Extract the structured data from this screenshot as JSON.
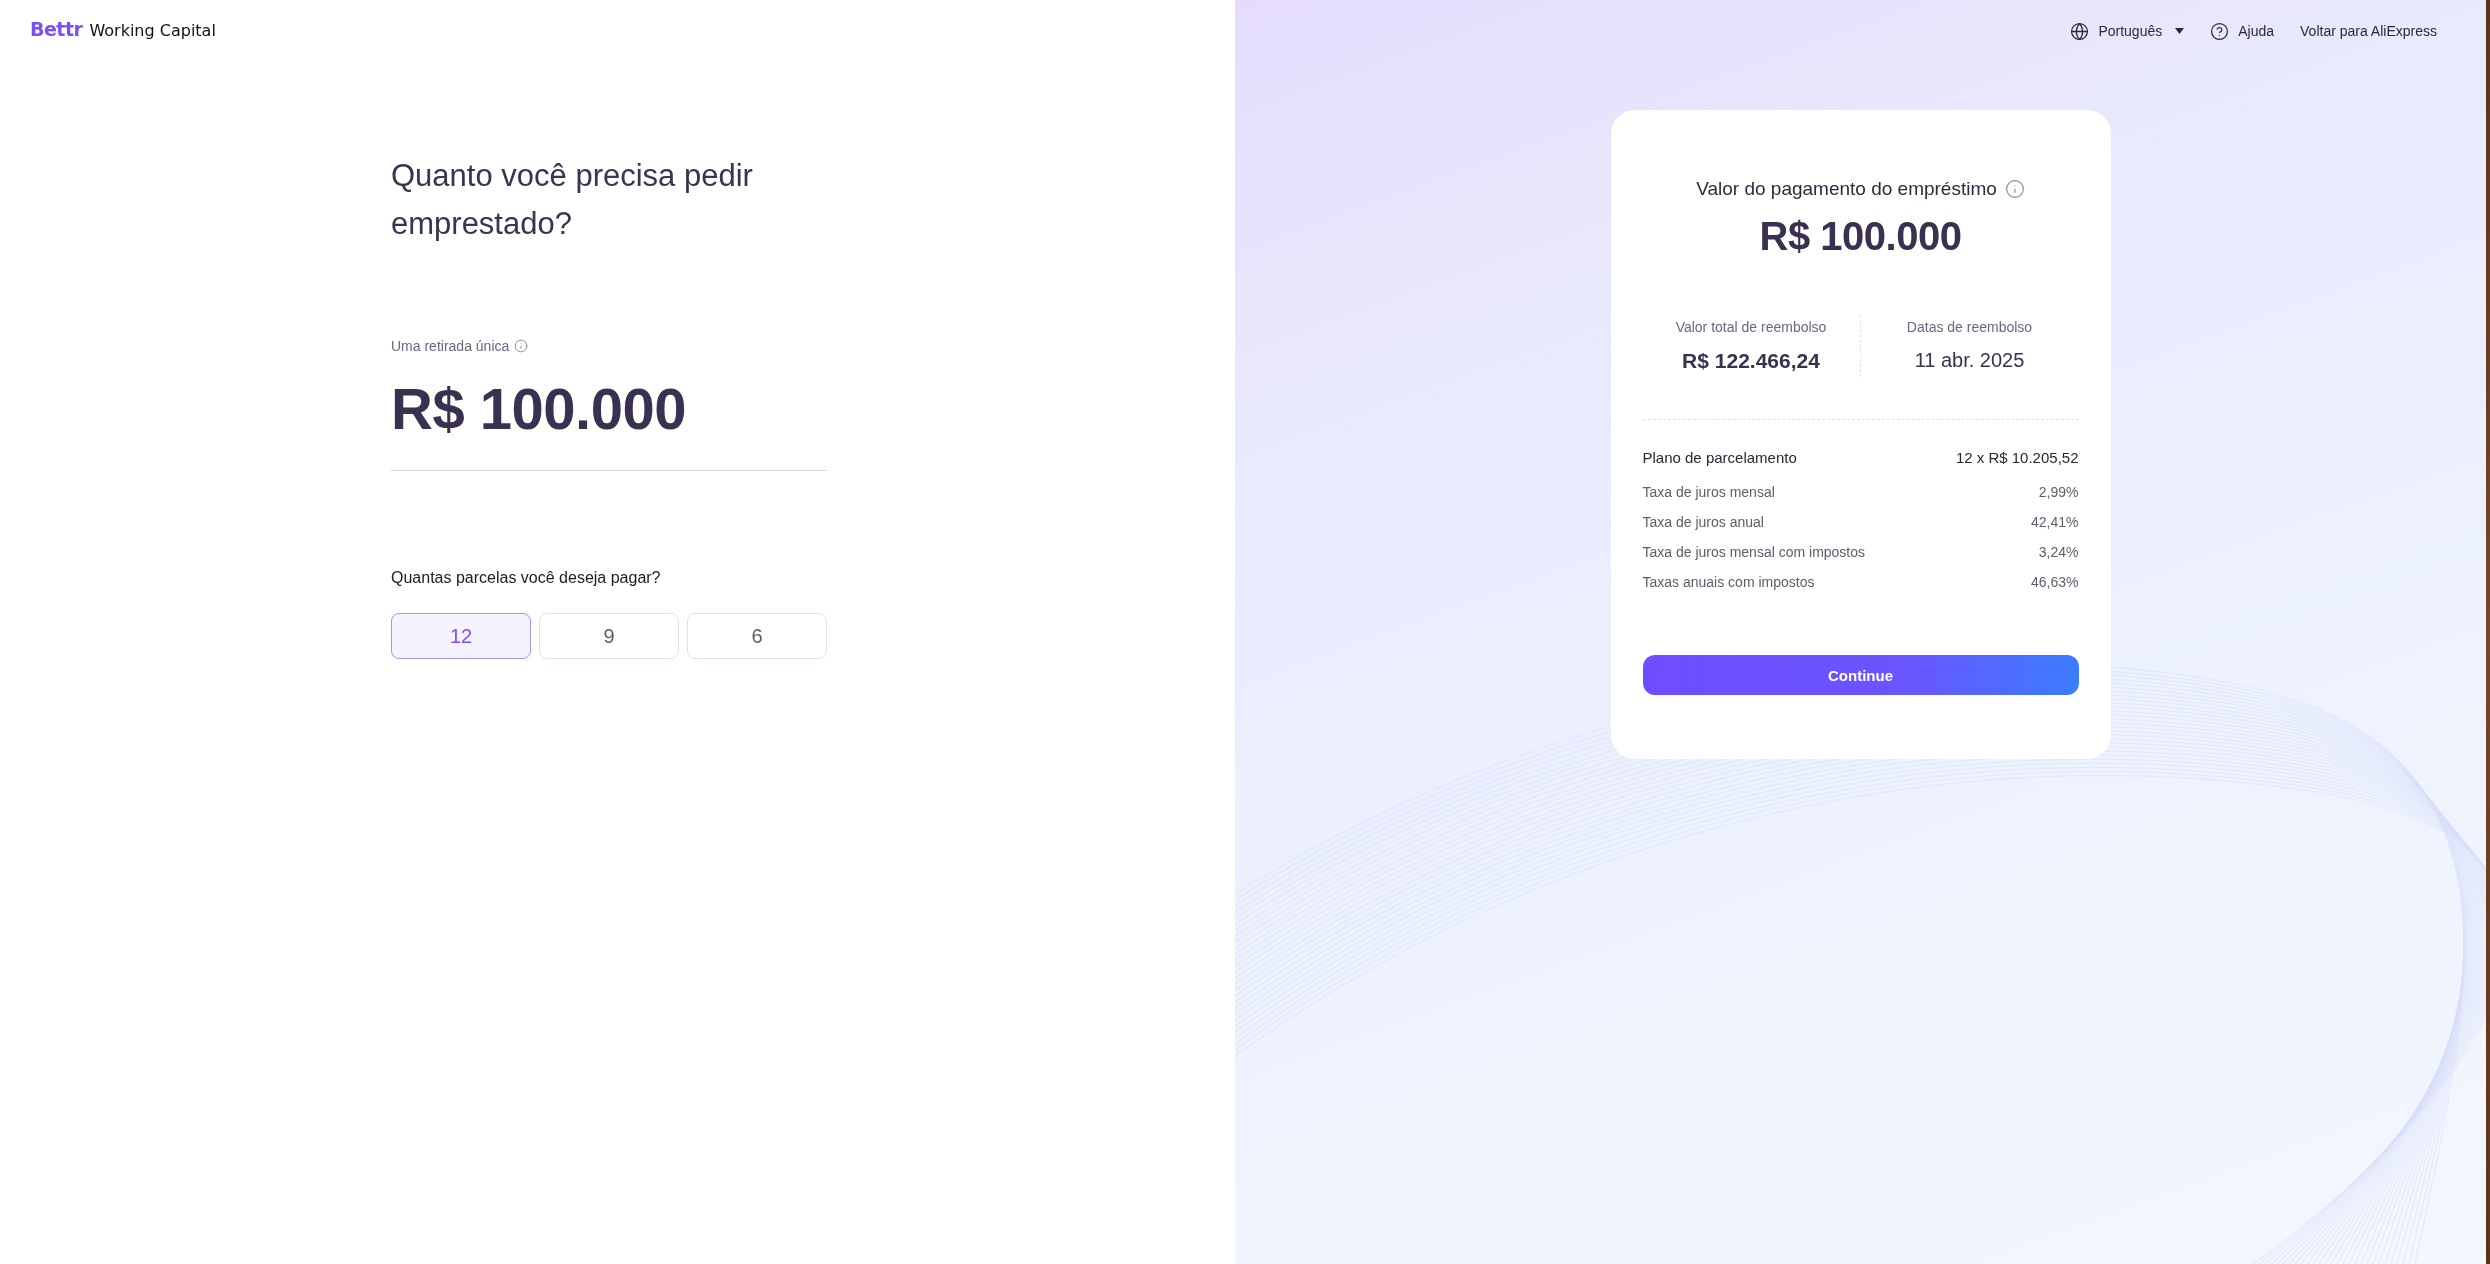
{
  "header": {
    "logo": {
      "brand": "Bettr",
      "product": "Working Capital"
    },
    "nav": [
      {
        "kind": "language",
        "label": "Português"
      },
      {
        "kind": "help",
        "label": "Ajuda"
      },
      {
        "kind": "link",
        "label": "Voltar para AliExpress"
      }
    ]
  },
  "loan_form": {
    "title": "Quanto você precisa pedir emprestado?",
    "amount_label": "Uma retirada única",
    "amount": "R$ 100.000",
    "installments_question": "Quantas parcelas você deseja pagar?",
    "installment_options": [
      {
        "label": "12",
        "selected": true
      },
      {
        "label": "9",
        "selected": false
      },
      {
        "label": "6",
        "selected": false
      }
    ]
  },
  "summary_card": {
    "title": "Valor do pagamento do empréstimo",
    "amount": "R$ 100.000",
    "stats": [
      {
        "kind": "amount",
        "label": "Valor total de reembolso",
        "value": "R$ 122.466,24"
      },
      {
        "kind": "date",
        "label": "Datas de reembolso",
        "value": "11 abr. 2025"
      }
    ],
    "plan": {
      "label": "Plano de parcelamento",
      "value": "12 x R$ 10.205,52"
    },
    "rates": [
      {
        "label": "Taxa de juros mensal",
        "value": "2,99%"
      },
      {
        "label": "Taxa de juros anual",
        "value": "42,41%"
      },
      {
        "label": "Taxa de juros mensal com impostos",
        "value": "3,24%"
      },
      {
        "label": "Taxas anuais com impostos",
        "value": "46,63%"
      }
    ],
    "button": "Continue"
  }
}
